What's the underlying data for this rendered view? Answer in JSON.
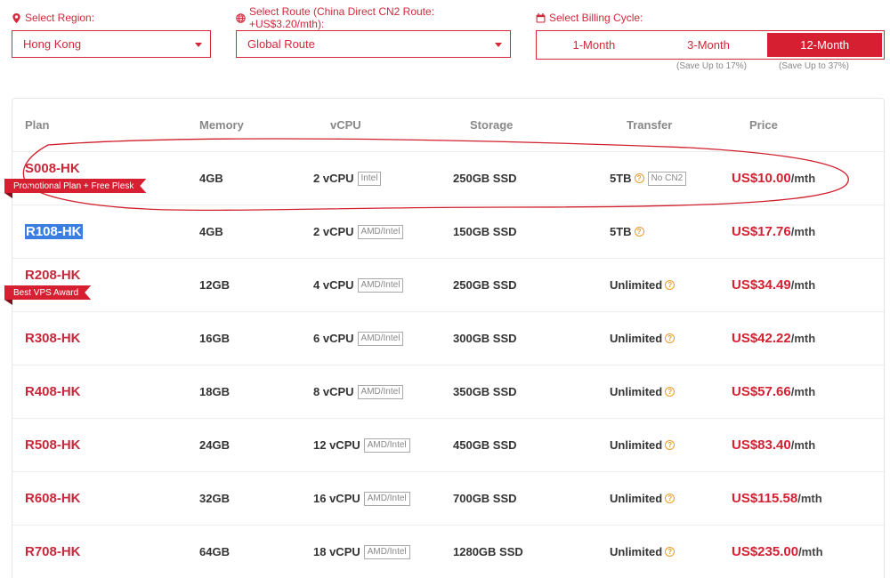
{
  "filters": {
    "region": {
      "label": "Select Region:",
      "icon": "map-marker-icon",
      "value": "Hong Kong"
    },
    "route": {
      "label": "Select Route (China Direct CN2 Route: +US$3.20/mth):",
      "icon": "globe-icon",
      "value": "Global Route"
    },
    "billing": {
      "label": "Select Billing Cycle:",
      "icon": "calendar-icon",
      "options": [
        "1-Month",
        "3-Month",
        "12-Month"
      ],
      "active": "12-Month",
      "save_3m": "(Save Up to 17%)",
      "save_12m": "(Save Up to 37%)"
    }
  },
  "table": {
    "headers": {
      "plan": "Plan",
      "memory": "Memory",
      "vcpu": "vCPU",
      "storage": "Storage",
      "transfer": "Transfer",
      "price": "Price"
    },
    "rows": [
      {
        "plan": "S008-HK",
        "ribbon": "Promotional Plan + Free Plesk",
        "memory": "4GB",
        "vcpu": "2 vCPU",
        "cpu_tag": "Intel",
        "storage": "250GB SSD",
        "transfer": "5TB",
        "transfer_tag": "No CN2",
        "price": "US$10.00",
        "unit": "/mth"
      },
      {
        "plan": "R108-HK",
        "memory": "4GB",
        "vcpu": "2 vCPU",
        "cpu_tag": "AMD/Intel",
        "storage": "150GB SSD",
        "transfer": "5TB",
        "price": "US$17.76",
        "unit": "/mth"
      },
      {
        "plan": "R208-HK",
        "ribbon": "Best VPS Award",
        "memory": "12GB",
        "vcpu": "4 vCPU",
        "cpu_tag": "AMD/Intel",
        "storage": "250GB SSD",
        "transfer": "Unlimited",
        "price": "US$34.49",
        "unit": "/mth"
      },
      {
        "plan": "R308-HK",
        "memory": "16GB",
        "vcpu": "6 vCPU",
        "cpu_tag": "AMD/Intel",
        "storage": "300GB SSD",
        "transfer": "Unlimited",
        "price": "US$42.22",
        "unit": "/mth"
      },
      {
        "plan": "R408-HK",
        "memory": "18GB",
        "vcpu": "8 vCPU",
        "cpu_tag": "AMD/Intel",
        "storage": "350GB SSD",
        "transfer": "Unlimited",
        "price": "US$57.66",
        "unit": "/mth"
      },
      {
        "plan": "R508-HK",
        "memory": "24GB",
        "vcpu": "12 vCPU",
        "cpu_tag": "AMD/Intel",
        "storage": "450GB SSD",
        "transfer": "Unlimited",
        "price": "US$83.40",
        "unit": "/mth"
      },
      {
        "plan": "R608-HK",
        "memory": "32GB",
        "vcpu": "16 vCPU",
        "cpu_tag": "AMD/Intel",
        "storage": "700GB SSD",
        "transfer": "Unlimited",
        "price": "US$115.58",
        "unit": "/mth"
      },
      {
        "plan": "R708-HK",
        "memory": "64GB",
        "vcpu": "18 vCPU",
        "cpu_tag": "AMD/Intel",
        "storage": "1280GB SSD",
        "transfer": "Unlimited",
        "price": "US$235.00",
        "unit": "/mth"
      }
    ]
  },
  "colors": {
    "accent": "#d62032",
    "plan_name": "#c8283c",
    "highlight": "#3b7de0",
    "help_icon": "#e89b2c"
  }
}
